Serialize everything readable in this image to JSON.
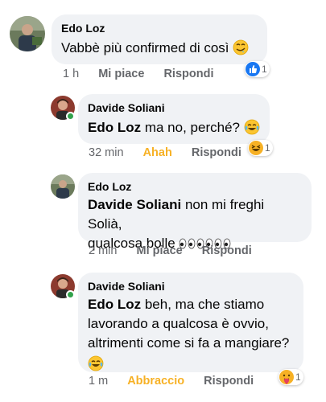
{
  "comments": [
    {
      "author": "Edo Loz",
      "text": "Vabbè più confirmed di così",
      "time": "1 h",
      "action": "Mi piace",
      "reply": "Rispondi",
      "reaction_count": "1",
      "reaction_icon": "like-icon"
    },
    {
      "author": "Davide Soliani",
      "mention": "Edo Loz",
      "text": "ma no, perché?",
      "time": "32 min",
      "action": "Ahah",
      "reply": "Rispondi",
      "reaction_count": "1",
      "reaction_icon": "laughing-icon"
    },
    {
      "author": "Edo Loz",
      "mention": "Davide Soliani",
      "text_line1": "non mi freghi Solià,",
      "text_line2": "qualcosa bolle",
      "time": "2 min",
      "action": "Mi piace",
      "reply": "Rispondi"
    },
    {
      "author": "Davide Soliani",
      "mention": "Edo Loz",
      "text_line1": "beh, ma che stiamo",
      "text_line2": "lavorando a qualcosa è ovvio,",
      "text_line3": "altrimenti come si fa a mangiare?",
      "time": "1 m",
      "action": "Abbraccio",
      "reply": "Rispondi",
      "reaction_count": "1",
      "reaction_icon": "care-icon"
    }
  ],
  "colors": {
    "bubble": "#f0f2f5",
    "meta": "#65676b",
    "like_blue": "#1877f2",
    "ahah_yellow": "#f7b125",
    "online_green": "#31a24c"
  }
}
